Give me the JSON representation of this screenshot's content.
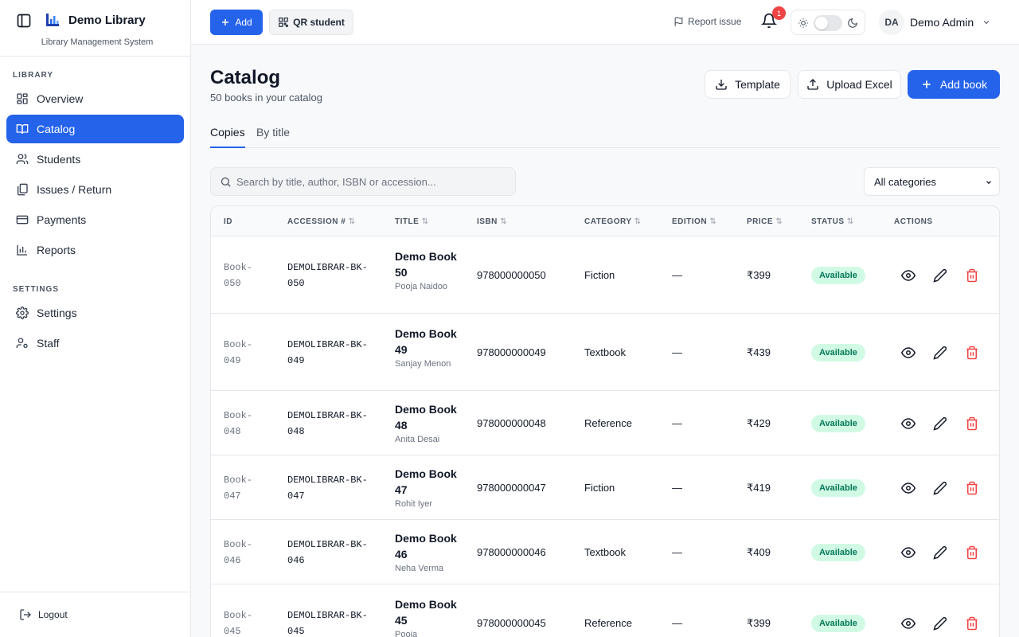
{
  "sidebar": {
    "app_name": "Demo Library",
    "app_subtitle": "Library Management System",
    "section_library": "LIBRARY",
    "section_settings": "SETTINGS",
    "items": [
      {
        "label": "Overview",
        "icon": "grid-icon"
      },
      {
        "label": "Catalog",
        "icon": "book-open-icon",
        "active": true
      },
      {
        "label": "Students",
        "icon": "users-icon"
      },
      {
        "label": "Issues / Return",
        "icon": "copy-icon"
      },
      {
        "label": "Payments",
        "icon": "credit-card-icon"
      },
      {
        "label": "Reports",
        "icon": "bar-chart-icon"
      },
      {
        "label": "Settings",
        "icon": "gear-icon"
      },
      {
        "label": "Staff",
        "icon": "user-cog-icon"
      }
    ],
    "logout_label": "Logout"
  },
  "topbar": {
    "add_label": "Add",
    "qr_label": "QR student",
    "report_label": "Report issue",
    "notification_count": "1",
    "avatar_initials": "DA",
    "user_name": "Demo Admin"
  },
  "page": {
    "title": "Catalog",
    "subtitle": "50 books in your catalog",
    "template_label": "Template",
    "upload_label": "Upload Excel",
    "add_book_label": "Add book",
    "tabs": [
      {
        "label": "Copies",
        "active": true
      },
      {
        "label": "By title",
        "active": false
      }
    ],
    "search_placeholder": "Search by title, author, ISBN or accession...",
    "category_filter": "All categories"
  },
  "table": {
    "columns": [
      "ID",
      "ACCESSION #",
      "TITLE",
      "ISBN",
      "CATEGORY",
      "EDITION",
      "PRICE",
      "STATUS",
      "ACTIONS"
    ],
    "sort_glyph": "⇅",
    "rows": [
      {
        "id": "Book-050",
        "accession": "DEMOLIBRAR-BK-050",
        "title": "Demo Book 50",
        "author": "Pooja Naidoo",
        "isbn": "978000000050",
        "category": "Fiction",
        "edition": "—",
        "price": "₹399",
        "status": "Available"
      },
      {
        "id": "Book-049",
        "accession": "DEMOLIBRAR-BK-049",
        "title": "Demo Book 49",
        "author": "Sanjay Menon",
        "isbn": "978000000049",
        "category": "Textbook",
        "edition": "—",
        "price": "₹439",
        "status": "Available"
      },
      {
        "id": "Book-048",
        "accession": "DEMOLIBRAR-BK-048",
        "title": "Demo Book 48",
        "author": "Anita Desai",
        "isbn": "978000000048",
        "category": "Reference",
        "edition": "—",
        "price": "₹429",
        "status": "Available"
      },
      {
        "id": "Book-047",
        "accession": "DEMOLIBRAR-BK-047",
        "title": "Demo Book 47",
        "author": "Rohit Iyer",
        "isbn": "978000000047",
        "category": "Fiction",
        "edition": "—",
        "price": "₹419",
        "status": "Available"
      },
      {
        "id": "Book-046",
        "accession": "DEMOLIBRAR-BK-046",
        "title": "Demo Book 46",
        "author": "Neha Verma",
        "isbn": "978000000046",
        "category": "Textbook",
        "edition": "—",
        "price": "₹409",
        "status": "Available"
      },
      {
        "id": "Book-045",
        "accession": "DEMOLIBRAR-BK-045",
        "title": "Demo Book 45",
        "author": "Pooja",
        "isbn": "978000000045",
        "category": "Reference",
        "edition": "—",
        "price": "₹399",
        "status": "Available"
      }
    ]
  },
  "colors": {
    "accent": "#2563eb",
    "status_bg": "#d1fae5",
    "status_text": "#047857",
    "danger": "#ef4444"
  }
}
